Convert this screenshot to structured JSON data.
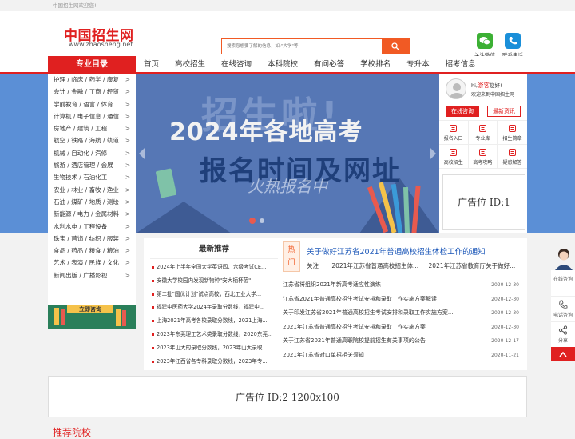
{
  "topbar": {
    "welcome": "中国招生网欢迎您!"
  },
  "header": {
    "logo_cn": "中国招生网",
    "logo_en": "www.zhaosheng.net",
    "search_placeholder": "搜索您想要了解的信息，如:\"大学\"等",
    "wechat_label": "关注微信",
    "phone_label": "联系电话"
  },
  "nav": {
    "category_title": "专业目录",
    "items": [
      "首页",
      "高校招生",
      "在线咨询",
      "本科院校",
      "有问必答",
      "学校排名",
      "专升本",
      "招考信息"
    ]
  },
  "sidebar": {
    "items": [
      "护理 / 临床 / 药学 / 康复",
      "会计 / 金融 / 工商 / 经贸",
      "学前教育 / 语言 / 体育",
      "计算机 / 电子信息 / 通信",
      "房地产 / 建筑 / 工程",
      "航空 / 铁路 / 海航 / 轨道",
      "机械 / 自动化 / 汽修",
      "旅游 / 酒店管理 / 会展",
      "生物技术 / 石油化工",
      "农业 / 林业 / 畜牧 / 渔业",
      "石油 / 煤矿 / 地质 / 测绘",
      "新能源 / 电力 / 金属材料",
      "水利水电 / 工程设备",
      "珠宝 / 首饰 / 纺织 / 服装",
      "食品 / 药品 / 粮食 / 粮油",
      "艺术 / 表演 / 民族 / 文化",
      "新闻出版 / 广播影视"
    ],
    "ad_text": "立即咨询"
  },
  "banner": {
    "headline_big": "招生啦!",
    "line1": "2024年各地高考",
    "line2": "报名时间及网址",
    "script": "火热报名中"
  },
  "user_panel": {
    "greeting": "hi,",
    "guest": "游客",
    "greeting_end": "您好!",
    "welcome": "欢迎来到中国招生网",
    "btn_consult": "在线咨询",
    "btn_news": "最新资讯",
    "grid": [
      "报名入口",
      "专业库",
      "招生简章",
      "高校招生",
      "高考攻略",
      "疑惑解答"
    ],
    "ad_label": "广告位 ID:1"
  },
  "recommend": {
    "title": "最新推荐",
    "items": [
      "2024年上半年全国大学英语四、六级考试CE...",
      "安徽大学校园内发现新物种\"安大柄杯菌\"",
      "第二批\"国优计划\"试点高校，西北工业大学...",
      "福建中医药大学2024年录取分数线，福建中...",
      "上海2021年高考各校录取分数线，2021上海...",
      "2023年东莞理工艺术类录取分数线，2020东莞...",
      "2023年山大的录取分数线，2023年山大录取...",
      "2023年江西省各专科录取分数线，2023年专..."
    ]
  },
  "hot": {
    "tag1": "热",
    "tag2": "门",
    "headline": "关于做好江苏省2021年普通高校招生体检工作的通知",
    "follow_label": "关注",
    "follow_links": [
      "2021年江苏省普通高校招生体...",
      "2021年江苏省教育厅关于做好..."
    ],
    "news": [
      {
        "title": "江苏省将组织2021年新高考适应性演练",
        "date": "2020-12-30"
      },
      {
        "title": "江苏省2021年普通高校招生考试安排和录取工作实施方案解读",
        "date": "2020-12-30"
      },
      {
        "title": "关于印发江苏省2021年普通高校招生考试安排和录取工作实施方案...",
        "date": "2020-12-30"
      },
      {
        "title": "2021年江苏省普通高校招生考试安排和录取工作实施方案",
        "date": "2020-12-30"
      },
      {
        "title": "关于江苏省2021年普通高职院校提前招生有关事项的公告",
        "date": "2020-12-17"
      },
      {
        "title": "2021年江苏省对口单招相关须知",
        "date": "2020-11-21"
      }
    ]
  },
  "ad2": {
    "label": "广告位 ID:2 1200x100"
  },
  "float": {
    "consult": "在线咨询",
    "phone": "电话咨询",
    "share": "分享"
  },
  "bottom": {
    "title": "推荐院校"
  },
  "colors": {
    "brand": "#e02020",
    "accent": "#f15a24",
    "banner_blue": "#5b8fd6"
  }
}
